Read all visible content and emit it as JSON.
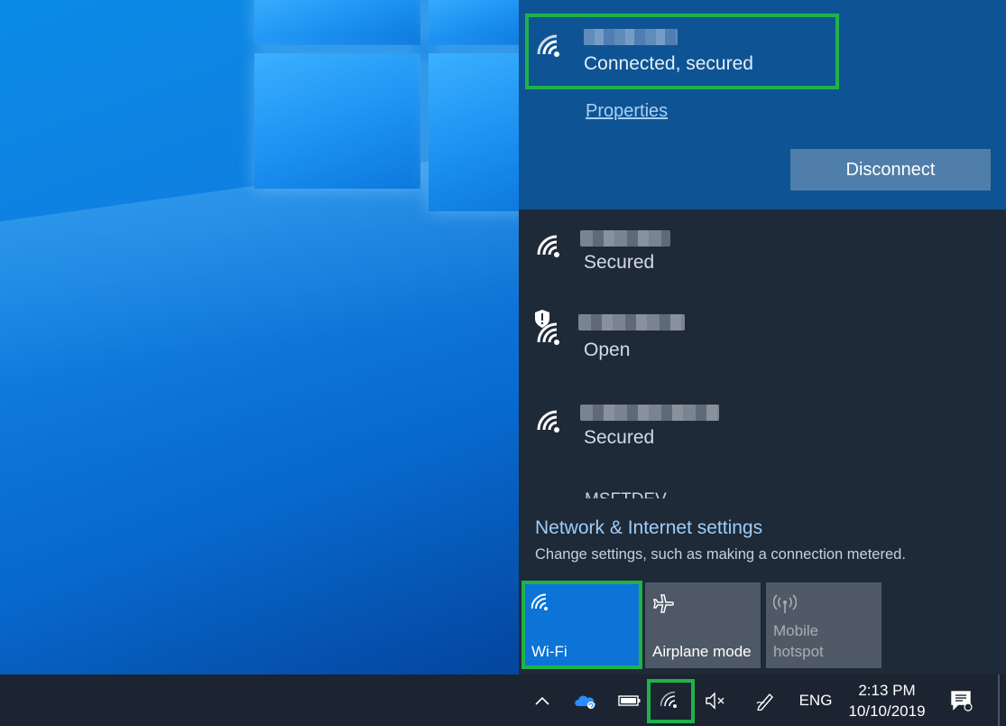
{
  "flyout": {
    "connected_network": {
      "status": "Connected, secured",
      "properties_label": "Properties",
      "disconnect_label": "Disconnect"
    },
    "networks": [
      {
        "status": "Secured"
      },
      {
        "status": "Open"
      },
      {
        "status": "Secured"
      },
      {
        "name": "MSFTDEV"
      }
    ],
    "settings": {
      "title": "Network & Internet settings",
      "subtitle": "Change settings, such as making a connection metered."
    },
    "quick_actions": [
      {
        "label": "Wi-Fi",
        "icon": "wifi-icon",
        "state": "on"
      },
      {
        "label": "Airplane mode",
        "icon": "airplane-icon",
        "state": "off"
      },
      {
        "label": "Mobile\nhotspot",
        "icon": "hotspot-icon",
        "state": "disabled"
      }
    ]
  },
  "taskbar": {
    "language": "ENG",
    "time": "2:13 PM",
    "date": "10/10/2019"
  },
  "colors": {
    "accent": "#0b74d6",
    "highlight_box": "#20b24a",
    "flyout_bg": "#1f2a38",
    "connected_bg": "#0e5494"
  }
}
